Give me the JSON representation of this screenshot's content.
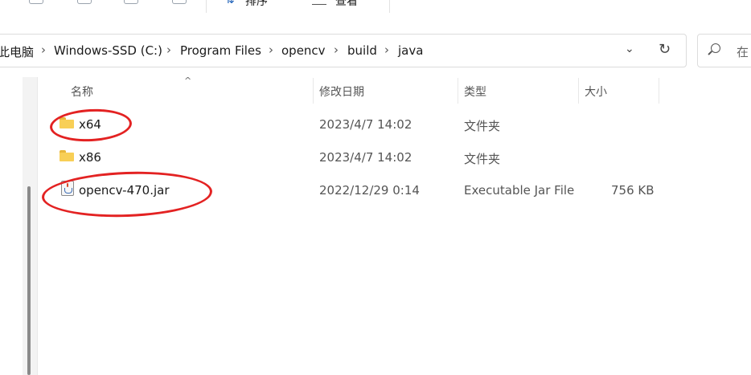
{
  "toolbar": {
    "sort_label": "排序",
    "view_label": "查看"
  },
  "address": {
    "crumbs": [
      "此电脑",
      "Windows-SSD (C:)",
      "Program Files",
      "opencv",
      "build",
      "java"
    ]
  },
  "search": {
    "placeholder": "在"
  },
  "columns": {
    "name": "名称",
    "date": "修改日期",
    "type": "类型",
    "size": "大小"
  },
  "files": [
    {
      "name": "x64",
      "date": "2023/4/7 14:02",
      "type": "文件夹",
      "size": "",
      "icon": "folder-icon"
    },
    {
      "name": "x86",
      "date": "2023/4/7 14:02",
      "type": "文件夹",
      "size": "",
      "icon": "folder-icon"
    },
    {
      "name": "opencv-470.jar",
      "date": "2022/12/29 0:14",
      "type": "Executable Jar File",
      "size": "756 KB",
      "icon": "java-jar-icon"
    }
  ],
  "colors": {
    "annotation": "#e32222",
    "folder": "#f8cf56",
    "accent": "#1b5fb8"
  }
}
